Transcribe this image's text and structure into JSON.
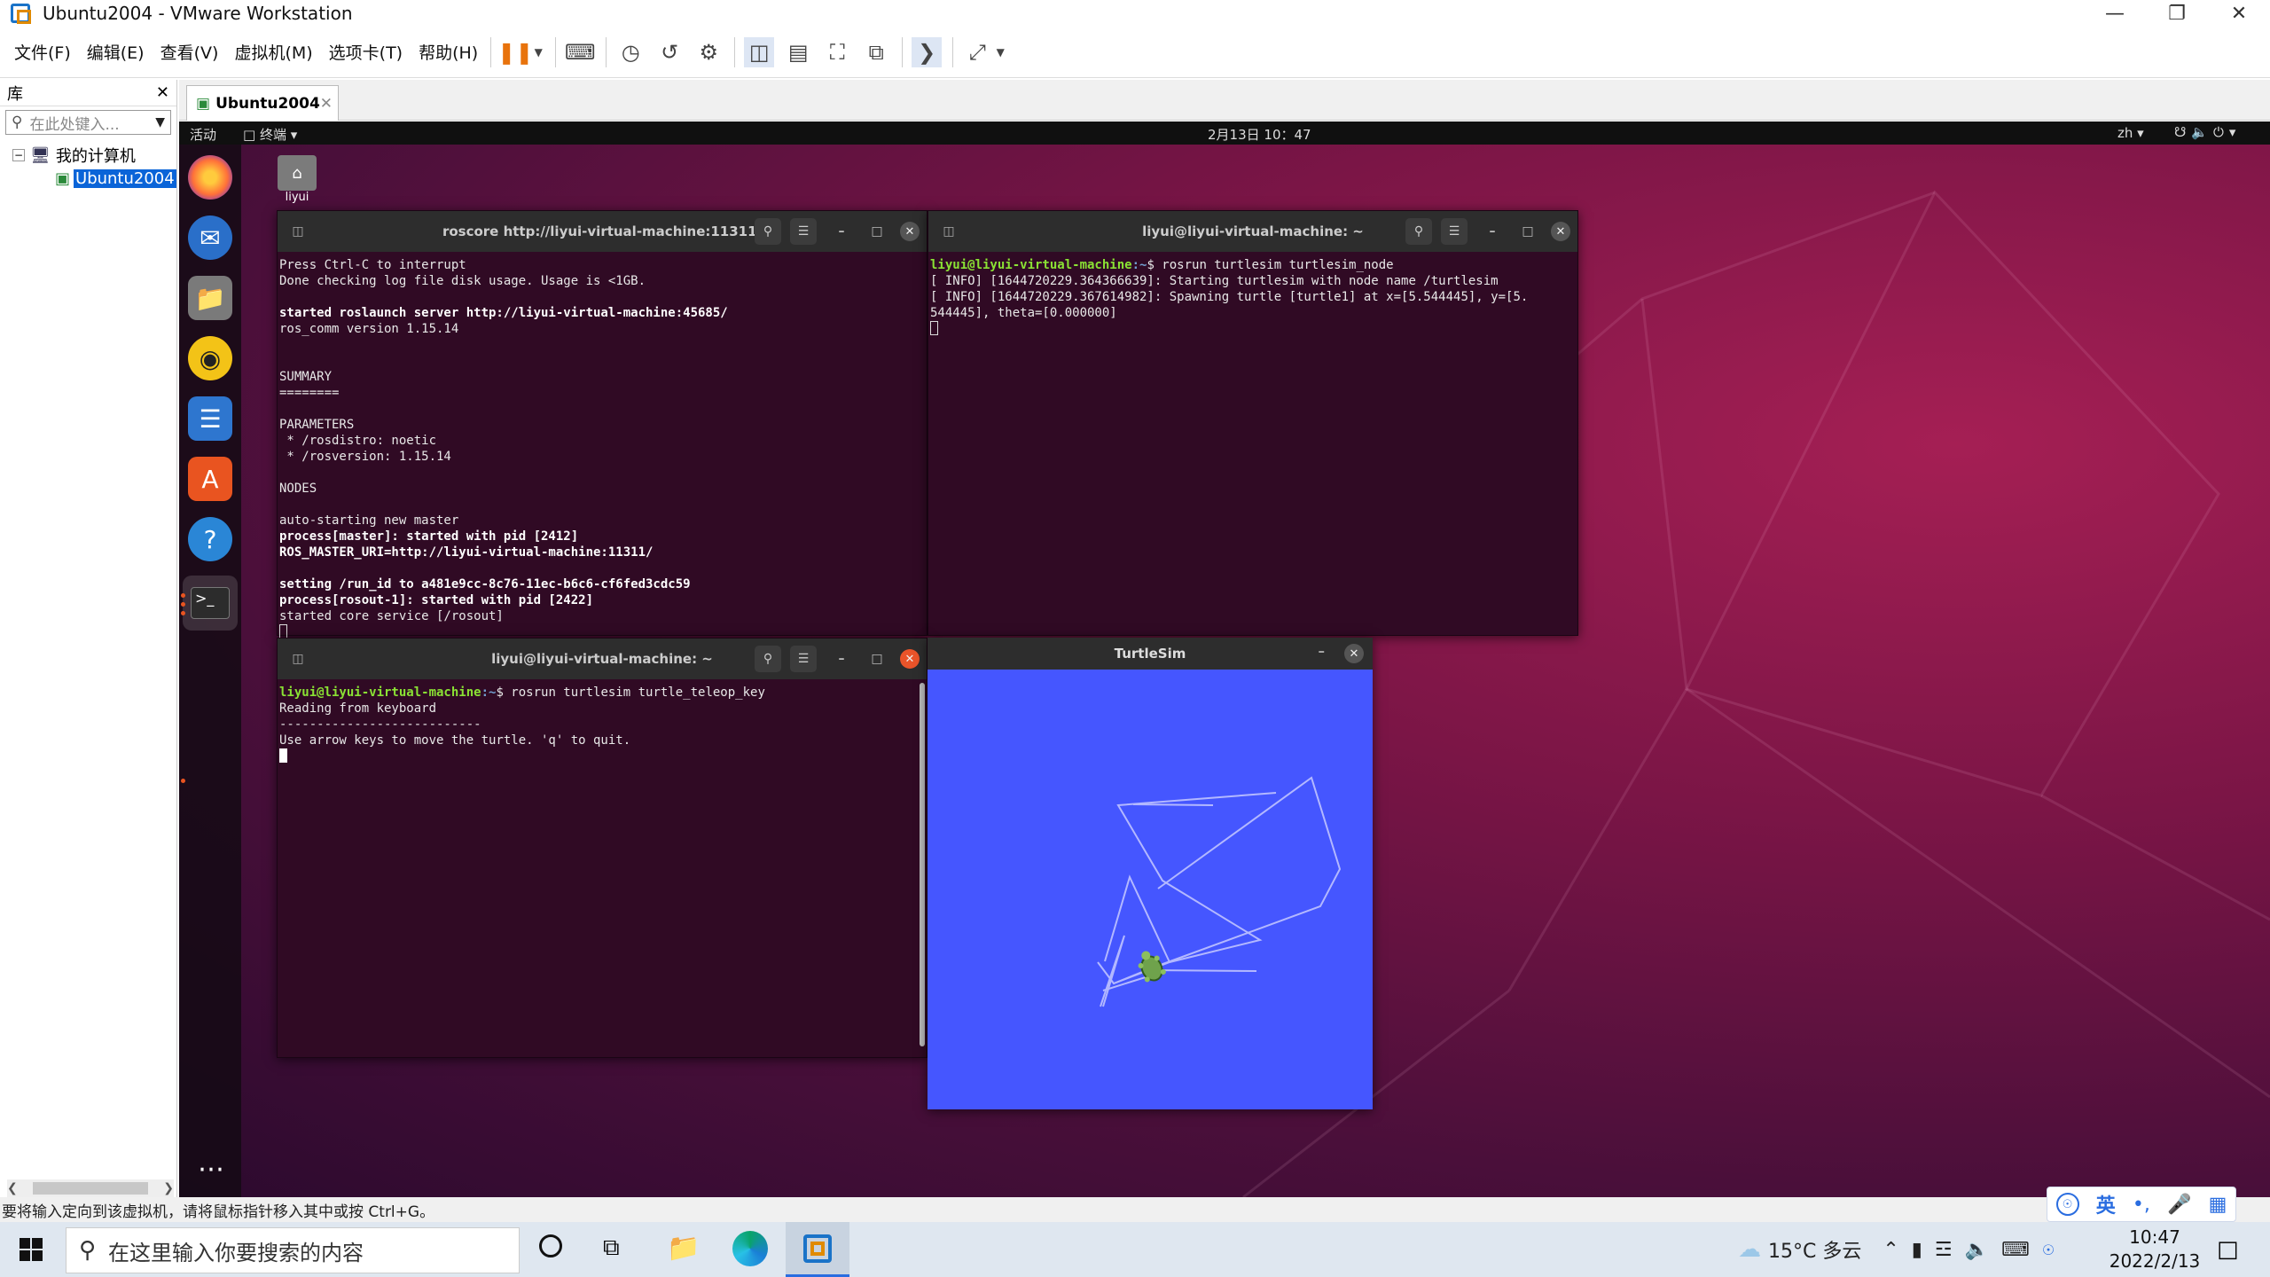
{
  "vm": {
    "title": "Ubuntu2004 - VMware Workstation",
    "menu": [
      "文件(F)",
      "编辑(E)",
      "查看(V)",
      "虚拟机(M)",
      "选项卡(T)",
      "帮助(H)"
    ],
    "library_title": "库",
    "library_search_placeholder": "在此处键入...",
    "tree_root": "我的计算机",
    "tree_vm": "Ubuntu2004",
    "tab_label": "Ubuntu2004",
    "status_hint": "要将输入定向到该虚拟机，请将鼠标指针移入其中或按 Ctrl+G。"
  },
  "ubuntu": {
    "activities": "活动",
    "app_menu": "终端 ▾",
    "clock": "2月13日 10：47",
    "lang": "zh ▾",
    "desktop_folder": "liyui"
  },
  "terminals": {
    "roscore": {
      "title": "roscore http://liyui-virtual-machine:11311/",
      "lines": [
        {
          "t": "Press Ctrl-C to interrupt",
          "s": ""
        },
        {
          "t": "Done checking log file disk usage. Usage is <1GB.",
          "s": ""
        },
        {
          "t": "",
          "s": ""
        },
        {
          "t": "started roslaunch server http://liyui-virtual-machine:45685/",
          "s": "b"
        },
        {
          "t": "ros_comm version 1.15.14",
          "s": ""
        },
        {
          "t": "",
          "s": ""
        },
        {
          "t": "",
          "s": ""
        },
        {
          "t": "SUMMARY",
          "s": ""
        },
        {
          "t": "========",
          "s": ""
        },
        {
          "t": "",
          "s": ""
        },
        {
          "t": "PARAMETERS",
          "s": ""
        },
        {
          "t": " * /rosdistro: noetic",
          "s": ""
        },
        {
          "t": " * /rosversion: 1.15.14",
          "s": ""
        },
        {
          "t": "",
          "s": ""
        },
        {
          "t": "NODES",
          "s": ""
        },
        {
          "t": "",
          "s": ""
        },
        {
          "t": "auto-starting new master",
          "s": ""
        },
        {
          "t": "process[master]: started with pid [2412]",
          "s": "b"
        },
        {
          "t": "ROS_MASTER_URI=http://liyui-virtual-machine:11311/",
          "s": "b"
        },
        {
          "t": "",
          "s": ""
        },
        {
          "t": "setting /run_id to a481e9cc-8c76-11ec-b6c6-cf6fed3cdc59",
          "s": "b"
        },
        {
          "t": "process[rosout-1]: started with pid [2422]",
          "s": "b"
        },
        {
          "t": "started core service [/rosout]",
          "s": ""
        }
      ]
    },
    "turtlesim_node": {
      "title": "liyui@liyui-virtual-machine: ~",
      "prompt_user": "liyui@liyui-virtual-machine",
      "prompt_path": ":~",
      "command": "$ rosrun turtlesim turtlesim_node",
      "lines": [
        "[ INFO] [1644720229.364366639]: Starting turtlesim with node name /turtlesim",
        "[ INFO] [1644720229.367614982]: Spawning turtle [turtle1] at x=[5.544445], y=[5.",
        "544445], theta=[0.000000]"
      ]
    },
    "teleop": {
      "title": "liyui@liyui-virtual-machine: ~",
      "prompt_user": "liyui@liyui-virtual-machine",
      "prompt_path": ":~",
      "command": "$ rosrun turtlesim turtle_teleop_key",
      "lines": [
        "Reading from keyboard",
        "---------------------------",
        "Use arrow keys to move the turtle. 'q' to quit."
      ]
    }
  },
  "turtlesim": {
    "title": "TurtleSim",
    "bg_color": "#4556ff",
    "pen_color": "#b3b8ff"
  },
  "taskbar": {
    "search_placeholder": "在这里输入你要搜索的内容",
    "weather": "15°C 多云",
    "time": "10:47",
    "date": "2022/2/13"
  },
  "ime": {
    "mode": "英"
  }
}
